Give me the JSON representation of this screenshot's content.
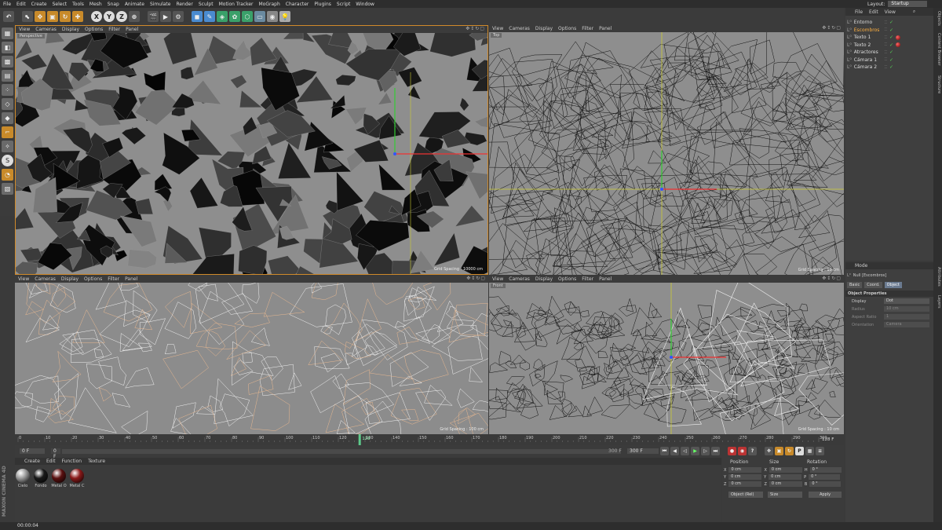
{
  "menu": [
    "File",
    "Edit",
    "Create",
    "Select",
    "Tools",
    "Mesh",
    "Snap",
    "Animate",
    "Simulate",
    "Render",
    "Sculpt",
    "Motion Tracker",
    "MoGraph",
    "Character",
    "Plugins",
    "Script",
    "Window"
  ],
  "layout": {
    "label": "Layout:",
    "value": "Startup"
  },
  "toolbar": {
    "x": "X",
    "y": "Y",
    "z": "Z"
  },
  "viewports": [
    {
      "name": "Perspective",
      "grid": "Grid Spacing : 10000 cm"
    },
    {
      "name": "Top",
      "grid": "Grid Spacing : 10 cm"
    },
    {
      "name": "",
      "grid": "Grid Spacing : 100 cm"
    },
    {
      "name": "Front",
      "grid": "Grid Spacing : 10 cm"
    }
  ],
  "vp_menu": [
    "View",
    "Cameras",
    "Display",
    "Options",
    "Filter",
    "Panel"
  ],
  "timeline": {
    "ticks": [
      "0",
      "10",
      "20",
      "30",
      "40",
      "50",
      "60",
      "70",
      "80",
      "90",
      "100",
      "110",
      "120",
      "128",
      "130",
      "140",
      "150",
      "160",
      "170",
      "180",
      "190",
      "200",
      "210",
      "220",
      "230",
      "240",
      "250",
      "260",
      "270",
      "280",
      "290",
      "300"
    ],
    "current": "128",
    "end_frame": "128 F"
  },
  "time_ctrl": {
    "start": "0 F",
    "start2": "0 F",
    "end_a": "300 F",
    "end_b": "300 F"
  },
  "materials": {
    "menu": [
      "Create",
      "Edit",
      "Function",
      "Texture"
    ],
    "items": [
      {
        "name": "Cielo",
        "color": "#9a9a9a"
      },
      {
        "name": "Fondo",
        "color": "#1a1a1a"
      },
      {
        "name": "Metal O",
        "color": "#5a1010"
      },
      {
        "name": "Metal C",
        "color": "#8a1a1a"
      }
    ]
  },
  "coords": {
    "headers": [
      "Position",
      "Size",
      "Rotation"
    ],
    "rows": [
      {
        "axis": "X",
        "pos": "0 cm",
        "saxis": "X",
        "size": "0 cm",
        "raxis": "H",
        "rot": "0 °"
      },
      {
        "axis": "Y",
        "pos": "0 cm",
        "saxis": "Y",
        "size": "0 cm",
        "raxis": "P",
        "rot": "0 °"
      },
      {
        "axis": "Z",
        "pos": "0 cm",
        "saxis": "Z",
        "size": "0 cm",
        "raxis": "B",
        "rot": "0 °"
      }
    ],
    "mode1": "Object (Rel)",
    "mode2": "Size",
    "apply": "Apply"
  },
  "status": "00:00:04",
  "objects": {
    "menu": [
      "File",
      "Edit",
      "View"
    ],
    "items": [
      {
        "name": "Entorno",
        "color": "#dddddd"
      },
      {
        "name": "Escombros",
        "color": "#ffb040"
      },
      {
        "name": "Texto 1",
        "color": "#dddddd"
      },
      {
        "name": "Texto 2",
        "color": "#dddddd"
      },
      {
        "name": "Atractores",
        "color": "#dddddd"
      },
      {
        "name": "Cámara 1",
        "color": "#dddddd"
      },
      {
        "name": "Cámara 2",
        "color": "#dddddd"
      }
    ]
  },
  "attributes": {
    "mode": "Mode",
    "title": "Null [Escombros]",
    "tabs": [
      "Basic",
      "Coord.",
      "Object"
    ],
    "section": "Object Properties",
    "props": [
      {
        "label": "Display",
        "value": "Dot"
      },
      {
        "label": "Radius",
        "value": "10 cm"
      },
      {
        "label": "Aspect Ratio",
        "value": "1"
      },
      {
        "label": "Orientation",
        "value": "Camera"
      }
    ]
  },
  "side_tabs": [
    "Objects",
    "Content Browser",
    "Structure",
    "Attributes",
    "Layers"
  ],
  "logo": "MAXON CINEMA 4D"
}
